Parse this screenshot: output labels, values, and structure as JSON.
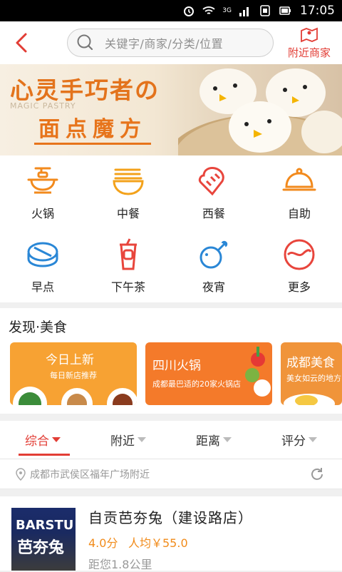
{
  "status_bar": {
    "time": "17:05",
    "network": "3G"
  },
  "header": {
    "search_placeholder": "关键字/商家/分类/位置",
    "nearby_label": "附近商家"
  },
  "banner": {
    "title": "心灵手巧者の",
    "subtitle": "MAGIC PASTRY",
    "tag": "面点魔方"
  },
  "categories": [
    {
      "label": "火锅",
      "icon": "hotpot-icon",
      "color": "#f28a1d"
    },
    {
      "label": "中餐",
      "icon": "noodle-bowl-icon",
      "color": "#f3a21b"
    },
    {
      "label": "西餐",
      "icon": "bread-icon",
      "color": "#e8453c"
    },
    {
      "label": "自助",
      "icon": "cloche-icon",
      "color": "#f28a1d"
    },
    {
      "label": "早点",
      "icon": "sushi-icon",
      "color": "#2a87d6"
    },
    {
      "label": "下午茶",
      "icon": "drink-cup-icon",
      "color": "#e8453c"
    },
    {
      "label": "夜宵",
      "icon": "drumstick-icon",
      "color": "#2a87d6"
    },
    {
      "label": "更多",
      "icon": "more-icon",
      "color": "#e8453c"
    }
  ],
  "discover": {
    "title": "发现·美食",
    "cards": [
      {
        "title": "今日上新",
        "subtitle": "每日新店推荐"
      },
      {
        "title": "四川火锅",
        "subtitle": "成都最巴适的20家火锅店"
      },
      {
        "title": "成都美食",
        "subtitle": "美女如云的地方"
      }
    ]
  },
  "filter_tabs": [
    {
      "label": "综合"
    },
    {
      "label": "附近"
    },
    {
      "label": "距离"
    },
    {
      "label": "评分"
    }
  ],
  "location": {
    "text": "成都市武侯区福年广场附近"
  },
  "shop": {
    "name": "自贡芭夯兔（建设路店）",
    "rating": "4.0分",
    "avg_price": "人均￥55.0",
    "distance": "距您1.8公里",
    "thumb_text_top": "BARSTU",
    "thumb_text_main": "芭夯兔"
  },
  "colors": {
    "accent": "#e23d35",
    "orange": "#f18b1a"
  }
}
